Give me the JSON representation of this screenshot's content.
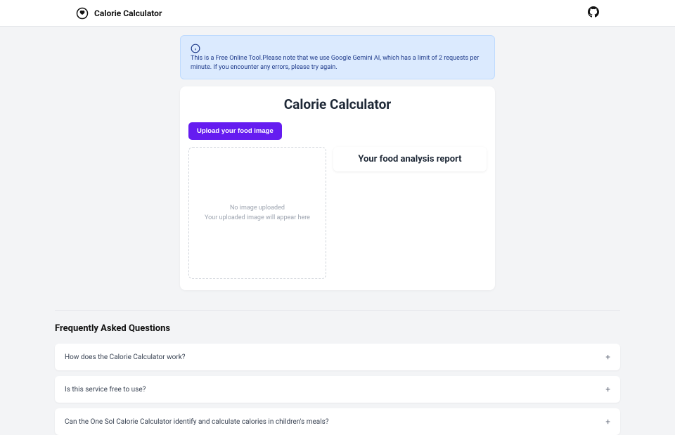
{
  "header": {
    "title": "Calorie Calculator"
  },
  "banner": {
    "text": "This is a Free Online Tool.Please note that we use Google Gemini AI, which has a limit of 2 requests per minute. If you encounter any errors, please try again."
  },
  "card": {
    "title": "Calorie Calculator",
    "upload_button": "Upload your food image",
    "dropzone": {
      "line1": "No image uploaded",
      "line2": "Your uploaded image will appear here"
    },
    "report_title": "Your food analysis report"
  },
  "faq": {
    "heading": "Frequently Asked Questions",
    "items": [
      {
        "question": "How does the Calorie Calculator work?"
      },
      {
        "question": "Is this service free to use?"
      },
      {
        "question": "Can the One Sol Calorie Calculator identify and calculate calories in children's meals?"
      }
    ]
  }
}
